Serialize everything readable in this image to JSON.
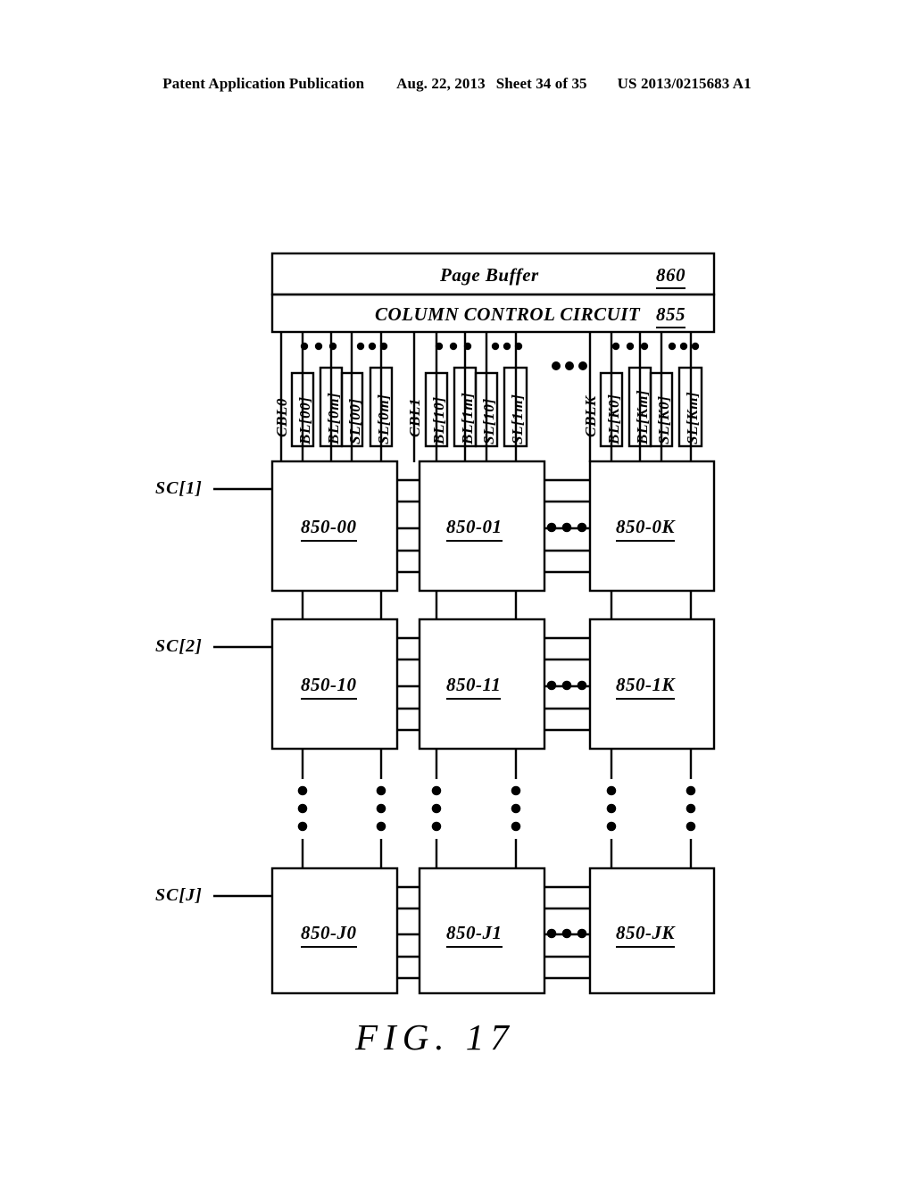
{
  "header": {
    "publication": "Patent Application Publication",
    "date": "Aug. 22, 2013",
    "sheet": "Sheet 34 of 35",
    "patent_number": "US 2013/0215683 A1"
  },
  "figure": {
    "caption": "FIG. 17",
    "top_blocks": [
      {
        "label": "Page Buffer",
        "ref": "860"
      },
      {
        "label": "COLUMN CONTROL CIRCUIT",
        "ref": "855"
      }
    ],
    "signal_groups": [
      {
        "group_label": "CBL0",
        "lines": [
          "BL[00]",
          "BL[0m]",
          "SL[00]",
          "SL[0m]"
        ],
        "ellipsis": "•••"
      },
      {
        "group_label": "CBL1",
        "lines": [
          "BL[10]",
          "BL[1m]",
          "SL[10]",
          "SL[1m]"
        ],
        "ellipsis": "•••"
      },
      {
        "group_label": "CBLK",
        "lines": [
          "BL[K0]",
          "BL[Km]",
          "SL[K0]",
          "SL[Km]"
        ],
        "ellipsis": "•••"
      }
    ],
    "group_ellipsis": "•••",
    "row_labels": [
      "SC[1]",
      "SC[2]",
      "SC[J]"
    ],
    "rows": [
      {
        "blocks": [
          "850-00",
          "850-01",
          "850-0K"
        ],
        "h_ellipsis": "•••"
      },
      {
        "blocks": [
          "850-10",
          "850-11",
          "850-1K"
        ],
        "h_ellipsis": "•••"
      },
      {
        "blocks": [
          "850-J0",
          "850-J1",
          "850-JK"
        ],
        "h_ellipsis": "•••"
      }
    ],
    "vertical_ellipsis_columns": 6,
    "colors": {
      "ink": "#000000",
      "paper": "#ffffff"
    }
  }
}
